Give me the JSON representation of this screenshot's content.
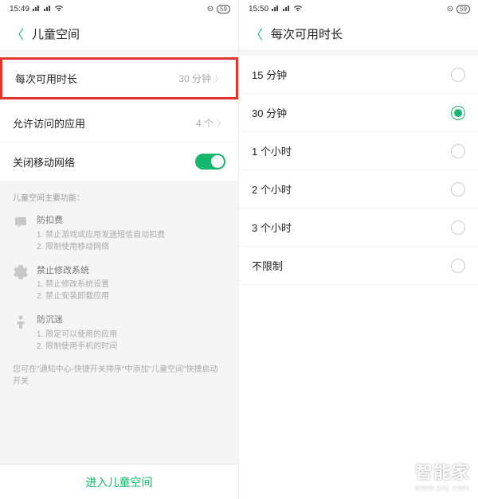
{
  "left": {
    "status": {
      "time": "15:49",
      "battery": "59"
    },
    "header": {
      "title": "儿童空间"
    },
    "rows": {
      "duration": {
        "label": "每次可用时长",
        "value": "30 分钟"
      },
      "apps": {
        "label": "允许访问的应用",
        "value": "4 个"
      },
      "mobile": {
        "label": "关闭移动网络"
      }
    },
    "info": {
      "heading": "儿童空间主要功能：",
      "items": [
        {
          "title": "防扣费",
          "lines": [
            "1. 禁止游戏或应用发送短信自动扣费",
            "2. 限制使用移动网络"
          ]
        },
        {
          "title": "禁止修改系统",
          "lines": [
            "1. 禁止修改系统设置",
            "2. 禁止安装卸载应用"
          ]
        },
        {
          "title": "防沉迷",
          "lines": [
            "1. 限定可以使用的应用",
            "2. 限制使用手机的时间"
          ]
        }
      ],
      "note": "您可在\"通知中心-快捷开关排序\"中添加\"儿童空间\"快捷启动开关"
    },
    "footer": {
      "label": "进入儿童空间"
    }
  },
  "right": {
    "status": {
      "time": "15:50",
      "battery": "59"
    },
    "header": {
      "title": "每次可用时长"
    },
    "options": [
      {
        "label": "15 分钟",
        "selected": false
      },
      {
        "label": "30 分钟",
        "selected": true
      },
      {
        "label": "1 个小时",
        "selected": false
      },
      {
        "label": "2 个小时",
        "selected": false
      },
      {
        "label": "3 个小时",
        "selected": false
      },
      {
        "label": "不限制",
        "selected": false
      }
    ]
  },
  "watermark": {
    "main": "智能家",
    "sub": "www.znj.com"
  }
}
